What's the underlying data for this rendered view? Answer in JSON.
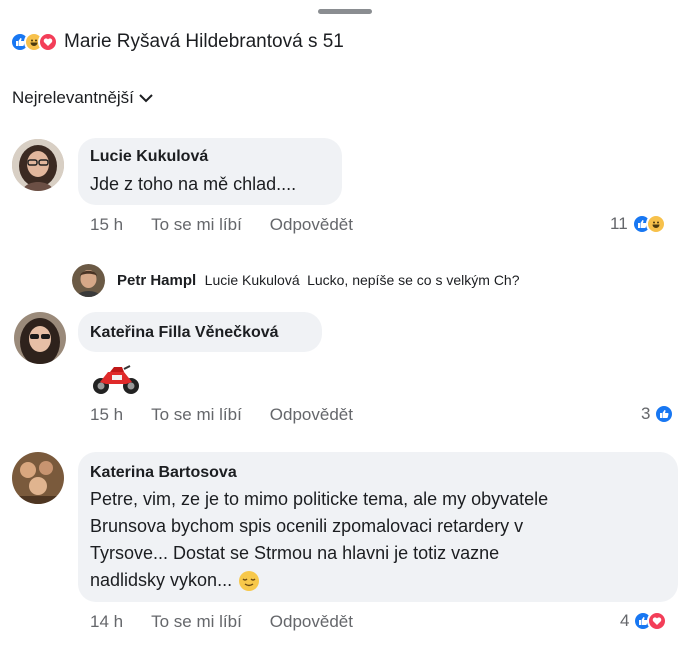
{
  "header": {
    "reactions": [
      "like",
      "haha",
      "love"
    ],
    "title": "Marie Ryšavá Hildebrantová s 51"
  },
  "sort": {
    "label": "Nejrelevantnější"
  },
  "comments": [
    {
      "author": "Lucie Kukulová",
      "text": "Jde z toho na mě chlad....",
      "time": "15 h",
      "like_label": "To se mi líbí",
      "reply_label": "Odpovědět",
      "reaction_count": "11",
      "reactions": [
        "like",
        "haha"
      ]
    },
    {
      "author": "Kateřina Filla Věnečková",
      "sticker": "motorcycle",
      "time": "15 h",
      "like_label": "To se mi líbí",
      "reply_label": "Odpovědět",
      "reaction_count": "3",
      "reactions": [
        "like"
      ]
    },
    {
      "author": "Katerina Bartosova",
      "text_lines": [
        "Petre, vim, ze je to mimo politicke tema, ale my obyvatele",
        "Brunsova bychom spis ocenili zpomalovaci retardery v",
        "Tyrsove... Dostat se Strmou na hlavni je totiz vazne",
        "nadlidsky vykon..."
      ],
      "time": "14 h",
      "like_label": "To se mi líbí",
      "reply_label": "Odpovědět",
      "reaction_count": "4",
      "reactions": [
        "like",
        "love"
      ]
    }
  ],
  "reply": {
    "author": "Petr Hampl",
    "mention": "Lucie Kukulová",
    "text": "Lucko, nepíše se co s velkým Ch?"
  }
}
